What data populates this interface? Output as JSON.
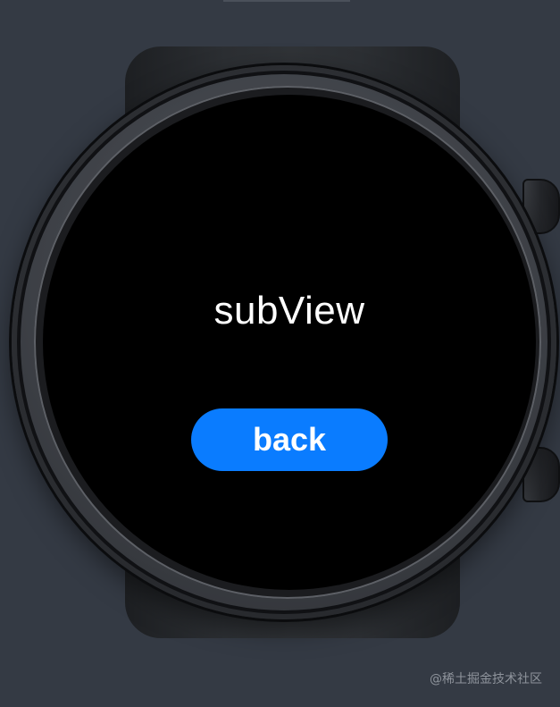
{
  "screen": {
    "title": "subView",
    "back_label": "back"
  },
  "watermark": {
    "text": "@稀土掘金技术社区"
  },
  "colors": {
    "background": "#343a44",
    "screen": "#000000",
    "button": "#0a7cff",
    "text": "#ffffff"
  }
}
